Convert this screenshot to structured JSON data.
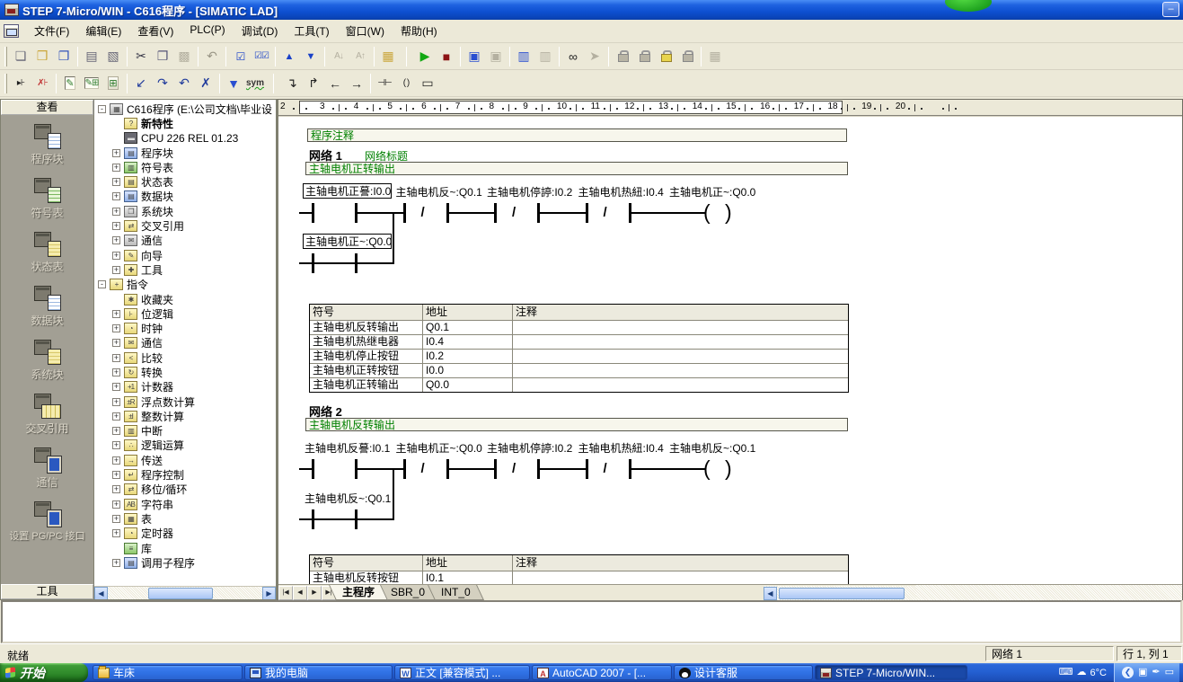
{
  "window": {
    "title": "STEP 7-Micro/WIN - C616程序 - [SIMATIC LAD]",
    "minimize": "–"
  },
  "menu": {
    "items": [
      "文件(F)",
      "编辑(E)",
      "查看(V)",
      "PLC(P)",
      "调试(D)",
      "工具(T)",
      "窗口(W)",
      "帮助(H)"
    ]
  },
  "toolbar_main": {
    "buttons": [
      {
        "name": "new-button",
        "glyph": "❏",
        "cls": "c-doc"
      },
      {
        "name": "open-button",
        "glyph": "❒",
        "cls": "c-open"
      },
      {
        "name": "save-all-button",
        "glyph": "❐",
        "cls": "c-save"
      },
      {
        "sep": true
      },
      {
        "name": "print-button",
        "glyph": "▤",
        "cls": "c-print"
      },
      {
        "name": "print-preview-button",
        "glyph": "▧",
        "cls": "c-print"
      },
      {
        "sep": true
      },
      {
        "name": "cut-button",
        "glyph": "✂",
        "cls": "c-cut"
      },
      {
        "name": "copy-button",
        "glyph": "❐",
        "cls": "c-copy"
      },
      {
        "name": "paste-button",
        "glyph": "▩",
        "cls": "c-dis"
      },
      {
        "sep": true
      },
      {
        "name": "undo-button",
        "glyph": "↶",
        "cls": "c-undo"
      },
      {
        "sep": true
      },
      {
        "name": "compile-button",
        "glyph": "☑",
        "cls": "c-compile"
      },
      {
        "name": "compile-all-button",
        "glyph": "☑☑",
        "cls": "c-compile smallg"
      },
      {
        "sep": true
      },
      {
        "name": "upload-button",
        "glyph": "▲",
        "cls": "c-updown"
      },
      {
        "name": "download-button",
        "glyph": "▼",
        "cls": "c-updown"
      },
      {
        "sep": true
      },
      {
        "name": "sort-ascending-button",
        "glyph": "A↓",
        "cls": "c-dis smallg"
      },
      {
        "name": "sort-descending-button",
        "glyph": "A↑",
        "cls": "c-dis smallg"
      },
      {
        "sep": true
      },
      {
        "name": "options-button",
        "glyph": "▦",
        "cls": "c-open"
      },
      {
        "sep": true,
        "wide": true
      },
      {
        "name": "run-button",
        "glyph": "▶",
        "cls": "c-run"
      },
      {
        "name": "stop-button",
        "glyph": "■",
        "cls": "c-stop"
      },
      {
        "sep": true
      },
      {
        "name": "program-status-button",
        "glyph": "▣",
        "cls": "c-blue"
      },
      {
        "name": "pause-program-status-button",
        "glyph": "▣",
        "cls": "c-dis"
      },
      {
        "sep": true
      },
      {
        "name": "chart-status-button",
        "glyph": "▥",
        "cls": "c-blue"
      },
      {
        "name": "pause-chart-status-button",
        "glyph": "▥",
        "cls": "c-dis"
      },
      {
        "sep": true
      },
      {
        "name": "status-glasses-button",
        "glyph": "∞",
        "cls": "c-dark"
      },
      {
        "name": "force-button",
        "glyph": "➤",
        "cls": "c-dis"
      },
      {
        "sep": true
      },
      {
        "name": "force-lock-button",
        "glyph": "",
        "cls": "padlock"
      },
      {
        "name": "unforce-button",
        "glyph": "",
        "cls": "padlock"
      },
      {
        "name": "timed-force-button",
        "glyph": "",
        "cls": "padlock gold"
      },
      {
        "name": "unforce-all-button",
        "glyph": "",
        "cls": "padlock"
      },
      {
        "sep": true
      },
      {
        "name": "memory-button",
        "glyph": "▦",
        "cls": "c-dis"
      }
    ]
  },
  "toolbar_instruction": {
    "buttons": [
      {
        "name": "next-bookmark-button",
        "glyph": "▸⊦",
        "cls": "c-dark smallg"
      },
      {
        "name": "clear-bookmarks-button",
        "glyph": "✗⊦",
        "cls": "c-red smallg"
      },
      {
        "sep": true
      },
      {
        "name": "view-project-button",
        "glyph": "✎",
        "cls": "c-viewbtn on"
      },
      {
        "name": "view-lad-button",
        "glyph": "✎⊞",
        "cls": "c-viewbtn on smallg"
      },
      {
        "name": "view-symbol-table-button",
        "glyph": "⊞",
        "cls": "c-viewbtn"
      },
      {
        "sep": true
      },
      {
        "name": "insert-branch-button",
        "glyph": "↙",
        "cls": "c-navy"
      },
      {
        "name": "insert-row-button",
        "glyph": "↷",
        "cls": "c-navy"
      },
      {
        "name": "delete-row-button",
        "glyph": "↶",
        "cls": "c-navy"
      },
      {
        "name": "delete-branch-button",
        "glyph": "✗",
        "cls": "c-navy"
      },
      {
        "sep": true
      },
      {
        "name": "symbol-info-table-button",
        "glyph": "▼",
        "cls": "c-blue"
      },
      {
        "name": "symbolic-addressing-button",
        "glyph": "sym",
        "cls": "c-sym"
      },
      {
        "sep": true,
        "wide": true
      },
      {
        "name": "line-down-button",
        "glyph": "↴",
        "cls": "c-dark"
      },
      {
        "name": "line-up-button",
        "glyph": "↱",
        "cls": "c-dark"
      },
      {
        "name": "line-left-button",
        "glyph": "←",
        "cls": "c-dark"
      },
      {
        "name": "line-right-button",
        "glyph": "→",
        "cls": "c-dark"
      },
      {
        "sep": true
      },
      {
        "name": "contact-button",
        "glyph": "⊣⊢",
        "cls": "c-dark smallg"
      },
      {
        "name": "coil-button",
        "glyph": "( )",
        "cls": "c-dark smallg"
      },
      {
        "name": "box-button",
        "glyph": "▭",
        "cls": "c-dark"
      }
    ]
  },
  "sidebar": {
    "header": "查看",
    "footer": "工具",
    "items": [
      {
        "label": "程序块",
        "icon": "program-block-icon",
        "front": ""
      },
      {
        "label": "符号表",
        "icon": "symbol-table-icon",
        "front": "green"
      },
      {
        "label": "状态表",
        "icon": "status-chart-icon",
        "front": "yellow"
      },
      {
        "label": "数据块",
        "icon": "data-block-icon",
        "front": ""
      },
      {
        "label": "系统块",
        "icon": "system-block-icon",
        "front": "yellow"
      },
      {
        "label": "交叉引用",
        "icon": "cross-reference-icon",
        "front": "wide"
      },
      {
        "label": "通信",
        "icon": "communications-icon",
        "front": "screen"
      },
      {
        "label": "设置 PG/PC 接口",
        "icon": "pgpc-interface-icon",
        "front": "screen"
      }
    ]
  },
  "tree": {
    "items": [
      {
        "e": "-",
        "i": "project-icon",
        "c": "gray",
        "g": "▦",
        "t": "C616程序 (E:\\公司文档\\毕业设",
        "d": 0
      },
      {
        "i": "new-features-icon",
        "c": "",
        "g": "?",
        "t": "新特性",
        "b": true,
        "d": 1
      },
      {
        "i": "cpu-icon",
        "c": "dark",
        "g": "▬",
        "t": "CPU 226 REL 01.23",
        "d": 1
      },
      {
        "e": "+",
        "i": "program-block-icon",
        "c": "blue",
        "g": "▤",
        "t": "程序块",
        "d": 1
      },
      {
        "e": "+",
        "i": "symbol-table-icon",
        "c": "green",
        "g": "▥",
        "t": "符号表",
        "d": 1
      },
      {
        "e": "+",
        "i": "status-chart-icon",
        "c": "",
        "g": "▤",
        "t": "状态表",
        "d": 1
      },
      {
        "e": "+",
        "i": "data-block-icon",
        "c": "blue",
        "g": "▤",
        "t": "数据块",
        "d": 1
      },
      {
        "e": "+",
        "i": "system-block-icon",
        "c": "gray",
        "g": "❐",
        "t": "系统块",
        "d": 1
      },
      {
        "e": "+",
        "i": "cross-reference-icon",
        "c": "",
        "g": "⇄",
        "t": "交叉引用",
        "d": 1
      },
      {
        "e": "+",
        "i": "communications-icon",
        "c": "gray",
        "g": "✉",
        "t": "通信",
        "d": 1
      },
      {
        "e": "+",
        "i": "wizard-icon",
        "c": "",
        "g": "✎",
        "t": "向导",
        "d": 1
      },
      {
        "e": "+",
        "i": "tools-icon",
        "c": "",
        "g": "✚",
        "t": "工具",
        "d": 1
      },
      {
        "e": "-",
        "i": "instructions-icon",
        "c": "",
        "g": "+",
        "t": "指令",
        "d": 0
      },
      {
        "i": "favorites-icon",
        "c": "",
        "g": "✱",
        "t": "收藏夹",
        "d": 1
      },
      {
        "e": "+",
        "i": "bit-logic-icon",
        "c": "",
        "g": "⊦",
        "t": "位逻辑",
        "d": 1
      },
      {
        "e": "+",
        "i": "clock-icon",
        "c": "",
        "g": "◔",
        "t": "时钟",
        "d": 1
      },
      {
        "e": "+",
        "i": "comm-icon",
        "c": "",
        "g": "✉",
        "t": "通信",
        "d": 1
      },
      {
        "e": "+",
        "i": "compare-icon",
        "c": "",
        "g": "<",
        "t": "比较",
        "d": 1
      },
      {
        "e": "+",
        "i": "convert-icon",
        "c": "",
        "g": "↻",
        "t": "转换",
        "d": 1
      },
      {
        "e": "+",
        "i": "counter-icon",
        "c": "",
        "g": "+1",
        "t": "计数器",
        "d": 1
      },
      {
        "e": "+",
        "i": "float-math-icon",
        "c": "",
        "g": "±R",
        "t": "浮点数计算",
        "d": 1
      },
      {
        "e": "+",
        "i": "int-math-icon",
        "c": "",
        "g": "±I",
        "t": "整数计算",
        "d": 1
      },
      {
        "e": "+",
        "i": "interrupt-icon",
        "c": "",
        "g": "▥",
        "t": "中断",
        "d": 1
      },
      {
        "e": "+",
        "i": "logic-ops-icon",
        "c": "",
        "g": "∴",
        "t": "逻辑运算",
        "d": 1
      },
      {
        "e": "+",
        "i": "move-icon",
        "c": "",
        "g": "→",
        "t": "传送",
        "d": 1
      },
      {
        "e": "+",
        "i": "program-control-icon",
        "c": "",
        "g": "↵",
        "t": "程序控制",
        "d": 1
      },
      {
        "e": "+",
        "i": "shift-rotate-icon",
        "c": "",
        "g": "⇄",
        "t": "移位/循环",
        "d": 1
      },
      {
        "e": "+",
        "i": "string-icon",
        "c": "",
        "g": "AB",
        "t": "字符串",
        "d": 1
      },
      {
        "e": "+",
        "i": "table-icon",
        "c": "",
        "g": "▦",
        "t": "表",
        "d": 1
      },
      {
        "e": "+",
        "i": "timer-icon",
        "c": "",
        "g": "◔",
        "t": "定时器",
        "d": 1
      },
      {
        "i": "library-icon",
        "c": "green",
        "g": "≡",
        "t": "库",
        "d": 1
      },
      {
        "e": "+",
        "i": "call-subroutine-icon",
        "c": "blue",
        "g": "▤",
        "t": "调用子程序",
        "d": 1
      }
    ]
  },
  "editor": {
    "ruler": {
      "from": 2,
      "to": 20,
      "box_from": 3,
      "box_to": 18
    },
    "program_comment": "程序注释",
    "networks": [
      {
        "label": "网络 1",
        "net_title": "网络标题",
        "title": "主轴电机正转输出",
        "rung": [
          {
            "type": "contact_no",
            "label": "主轴电机正謩:I0.0",
            "selected": true
          },
          {
            "type": "contact_nc",
            "label": "主轴电机反~:Q0.1"
          },
          {
            "type": "contact_nc",
            "label": "主轴电机停諪:I0.2"
          },
          {
            "type": "contact_nc",
            "label": "主轴电机热紐:I0.4"
          },
          {
            "type": "coil",
            "label": "主轴电机正~:Q0.0"
          }
        ],
        "branch": {
          "type": "contact_no",
          "label": "主轴电机正~:Q0.0",
          "boxed": true
        },
        "symbols": {
          "headers": [
            "符号",
            "地址",
            "注释"
          ],
          "rows": [
            [
              "主轴电机反转输出",
              "Q0.1",
              ""
            ],
            [
              "主轴电机热继电器",
              "I0.4",
              ""
            ],
            [
              "主轴电机停止按钮",
              "I0.2",
              ""
            ],
            [
              "主轴电机正转按钮",
              "I0.0",
              ""
            ],
            [
              "主轴电机正转输出",
              "Q0.0",
              ""
            ]
          ]
        }
      },
      {
        "label": "网络 2",
        "net_title": "",
        "title": "主轴电机反转输出",
        "rung": [
          {
            "type": "contact_no",
            "label": "主轴电机反謩:I0.1"
          },
          {
            "type": "contact_nc",
            "label": "主轴电机正~:Q0.0"
          },
          {
            "type": "contact_nc",
            "label": "主轴电机停諪:I0.2"
          },
          {
            "type": "contact_nc",
            "label": "主轴电机热紐:I0.4"
          },
          {
            "type": "coil",
            "label": "主轴电机反~:Q0.1"
          }
        ],
        "branch": {
          "type": "contact_no",
          "label": "主轴电机反~:Q0.1",
          "boxed": false
        },
        "symbols": {
          "headers": [
            "符号",
            "地址",
            "注释"
          ],
          "rows": [
            [
              "主轴电机反转按钮",
              "I0.1",
              ""
            ]
          ]
        }
      }
    ],
    "tabs": [
      {
        "label": "主程序",
        "active": true
      },
      {
        "label": "SBR_0",
        "active": false
      },
      {
        "label": "INT_0",
        "active": false
      }
    ]
  },
  "statusbar": {
    "ready": "就绪",
    "network": "网络 1",
    "position": "行 1, 列 1"
  },
  "taskbar": {
    "start": "开始",
    "tasks": [
      {
        "label": "车床",
        "icon": "folder-icon",
        "glyph": "",
        "width": 167
      },
      {
        "label": "我的电脑",
        "icon": "computer-icon",
        "glyph": "",
        "width": 165
      },
      {
        "label": "正文 [兼容模式] ...",
        "icon": "word-icon",
        "glyph": "W",
        "width": 151
      },
      {
        "label": "AutoCAD 2007 - [...",
        "icon": "autocad-icon",
        "glyph": "A",
        "width": 156
      },
      {
        "label": "设计客服",
        "icon": "penguin-icon",
        "glyph": "",
        "width": 155
      },
      {
        "label": "STEP 7-Micro/WIN...",
        "icon": "step7-icon",
        "glyph": "",
        "width": 170,
        "active": true
      }
    ],
    "tray": {
      "temp": "6°C",
      "dark_icons": [
        {
          "name": "keyboard-icon",
          "glyph": "⌨"
        },
        {
          "name": "weather-cloud-icon",
          "glyph": "☁"
        }
      ],
      "light_icons": [
        {
          "name": "rollback-icon",
          "glyph": "❮",
          "circ": true
        },
        {
          "name": "display-settings-icon",
          "glyph": "▣"
        },
        {
          "name": "pen-input-icon",
          "glyph": "✒"
        },
        {
          "name": "network-monitor-icon",
          "glyph": "▭"
        }
      ]
    }
  }
}
